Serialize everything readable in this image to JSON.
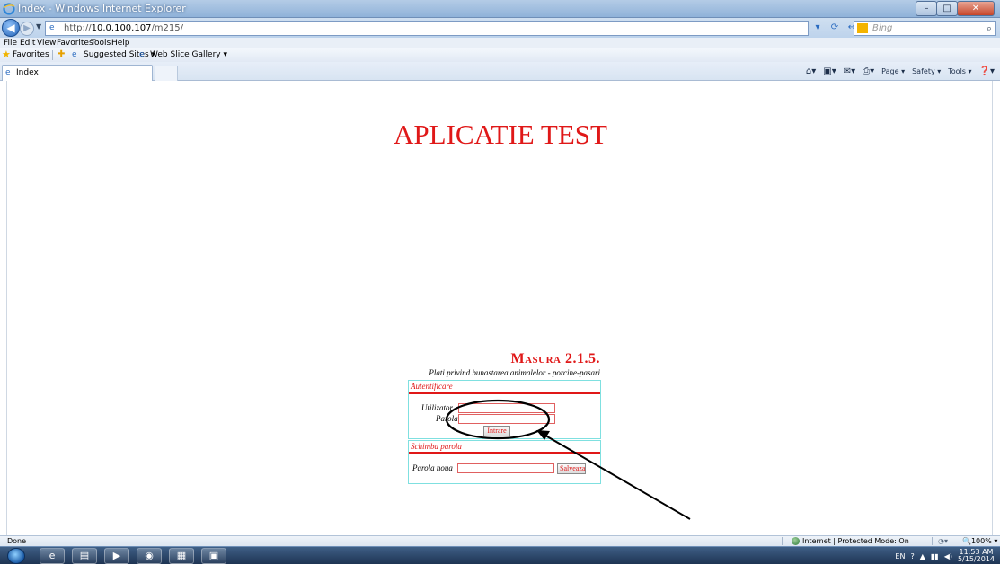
{
  "window": {
    "title": "Index - Windows Internet Explorer",
    "controls": [
      "–",
      "□",
      "✕"
    ]
  },
  "address_bar": {
    "url_prefix": "http://",
    "url_host": "10.0.100.107",
    "url_path": "/m215/",
    "search_placeholder": "Bing",
    "tools": [
      "▾",
      "⟳",
      "↔",
      "✕"
    ]
  },
  "menu": [
    "File",
    "Edit",
    "View",
    "Favorites",
    "Tools",
    "Help"
  ],
  "favorites_bar": {
    "favorites_label": "Favorites",
    "suggested_sites": "Suggested Sites ▾",
    "web_slice_gallery": "Web Slice Gallery ▾"
  },
  "tab": {
    "label": "Index"
  },
  "command_bar": {
    "page": "Page ▾",
    "safety": "Safety ▾",
    "tools": "Tools ▾",
    "help": "▾"
  },
  "page": {
    "app_title": "APLICATIE TEST",
    "masura_title": "Masura 2.1.5.",
    "subtitle": "Plati privind bunastarea animalelor - porcine-pasari",
    "auth_section": {
      "heading": "Autentificare",
      "user_label": "Utilizator",
      "password_label": "Parola",
      "user_value": "",
      "password_value": "",
      "submit_label": "Intrare"
    },
    "change_password_section": {
      "heading": "Schimba parola",
      "new_password_label": "Parola noua",
      "new_password_value": "",
      "save_label": "Salveaza"
    }
  },
  "status_bar": {
    "status": "Done",
    "zone": "Internet | Protected Mode: On",
    "zoom": "100%"
  },
  "taskbar": {
    "language": "EN",
    "time": "11:53 AM",
    "date": "5/15/2014"
  },
  "colors": {
    "accent_red": "#e01818",
    "box_border": "#7fe0e0"
  }
}
